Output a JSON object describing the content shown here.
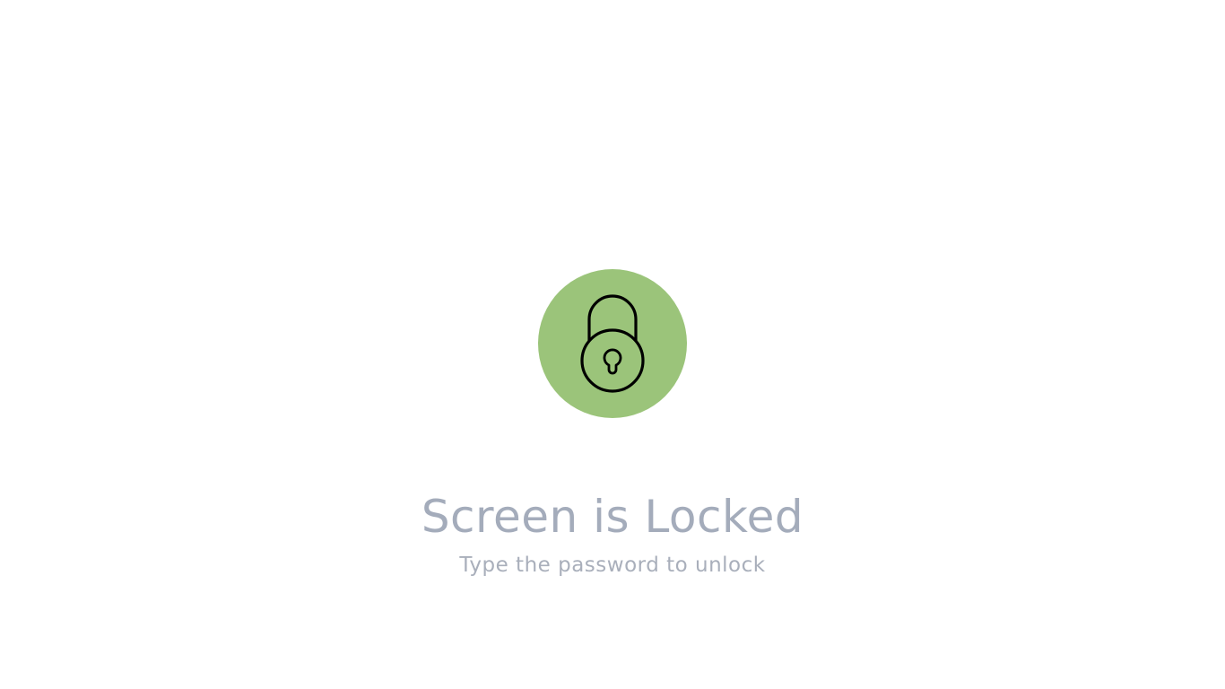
{
  "lock_screen": {
    "icon": "padlock-icon",
    "icon_background": "#9bc47a",
    "title": "Screen is Locked",
    "subtitle": "Type the password to unlock",
    "text_color": "#a4acbb"
  }
}
